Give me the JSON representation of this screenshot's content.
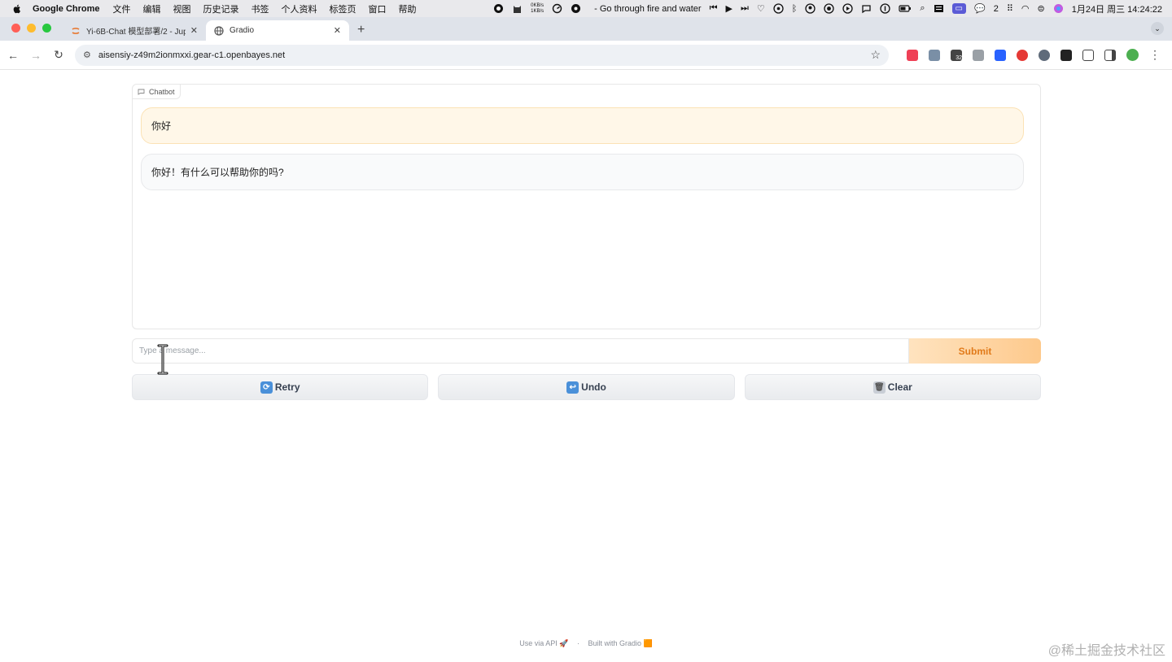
{
  "menubar": {
    "app_name": "Google Chrome",
    "menus": [
      "文件",
      "编辑",
      "视图",
      "历史记录",
      "书签",
      "个人资料",
      "标签页",
      "窗口",
      "帮助"
    ],
    "net_speed_up": "0KB/s",
    "net_speed_down": "1KB/s",
    "now_playing": "- Go through fire and water",
    "wechat_count": "2",
    "input_method": "拼",
    "clock": "1月24日 周三  14:24:22"
  },
  "tabs": [
    {
      "title": "Yi-6B-Chat 模型部署/2 - Jupyter",
      "active": false
    },
    {
      "title": "Gradio",
      "active": true
    }
  ],
  "toolbar": {
    "url": "aisensiy-z49m2ionmxxi.gear-c1.openbayes.net",
    "extension_badge": "32"
  },
  "chatbot": {
    "label": "Chatbot",
    "messages": [
      {
        "role": "user",
        "text": "你好"
      },
      {
        "role": "bot",
        "text": "你好！有什么可以帮助你的吗?"
      }
    ]
  },
  "input": {
    "placeholder": "Type a message...",
    "value": "",
    "submit_label": "Submit"
  },
  "actions": {
    "retry_label": "Retry",
    "undo_label": "Undo",
    "clear_label": "Clear"
  },
  "footer": {
    "api_label": "Use via API",
    "separator": "·",
    "built_label": "Built with Gradio"
  },
  "watermark": "@稀土掘金技术社区",
  "colors": {
    "user_bubble": "#fff7e8",
    "bot_bubble": "#f9fafb",
    "submit_text": "#e17a1a",
    "accent": "#fdc98c"
  }
}
